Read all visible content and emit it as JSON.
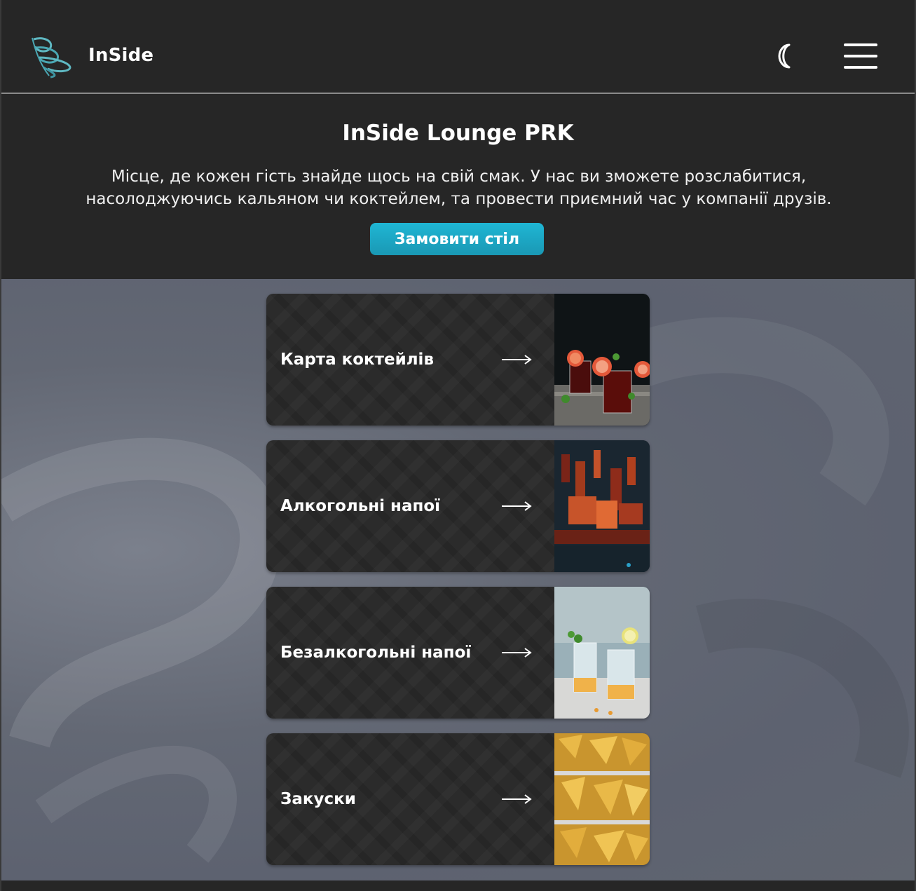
{
  "header": {
    "brand": "InSide",
    "logo_icon": "inside-wave-logo-icon",
    "theme_icon": "moon-icon",
    "menu_icon": "hamburger-menu-icon"
  },
  "hero": {
    "title": "InSide Lounge PRK",
    "description_line1": "Місце, де кожен гість знайде щось на свій смак. У нас ви зможете розслабитися,",
    "description_line2": "насолоджуючись кальяном чи коктейлем, та провести приємний час у компанії друзів.",
    "cta_label": "Замовити стіл"
  },
  "menu": {
    "items": [
      {
        "label": "Карта коктейлів",
        "image": "cocktails-photo"
      },
      {
        "label": "Алкогольні напої",
        "image": "alcohol-bar-photo"
      },
      {
        "label": "Безалкогольні напої",
        "image": "lemonade-photo"
      },
      {
        "label": "Закуски",
        "image": "nachos-photo"
      }
    ]
  },
  "colors": {
    "accent": "#1fb6d4",
    "header_bg": "#262626",
    "card_bg": "#2b2b2b",
    "section_bg": "#636874"
  }
}
